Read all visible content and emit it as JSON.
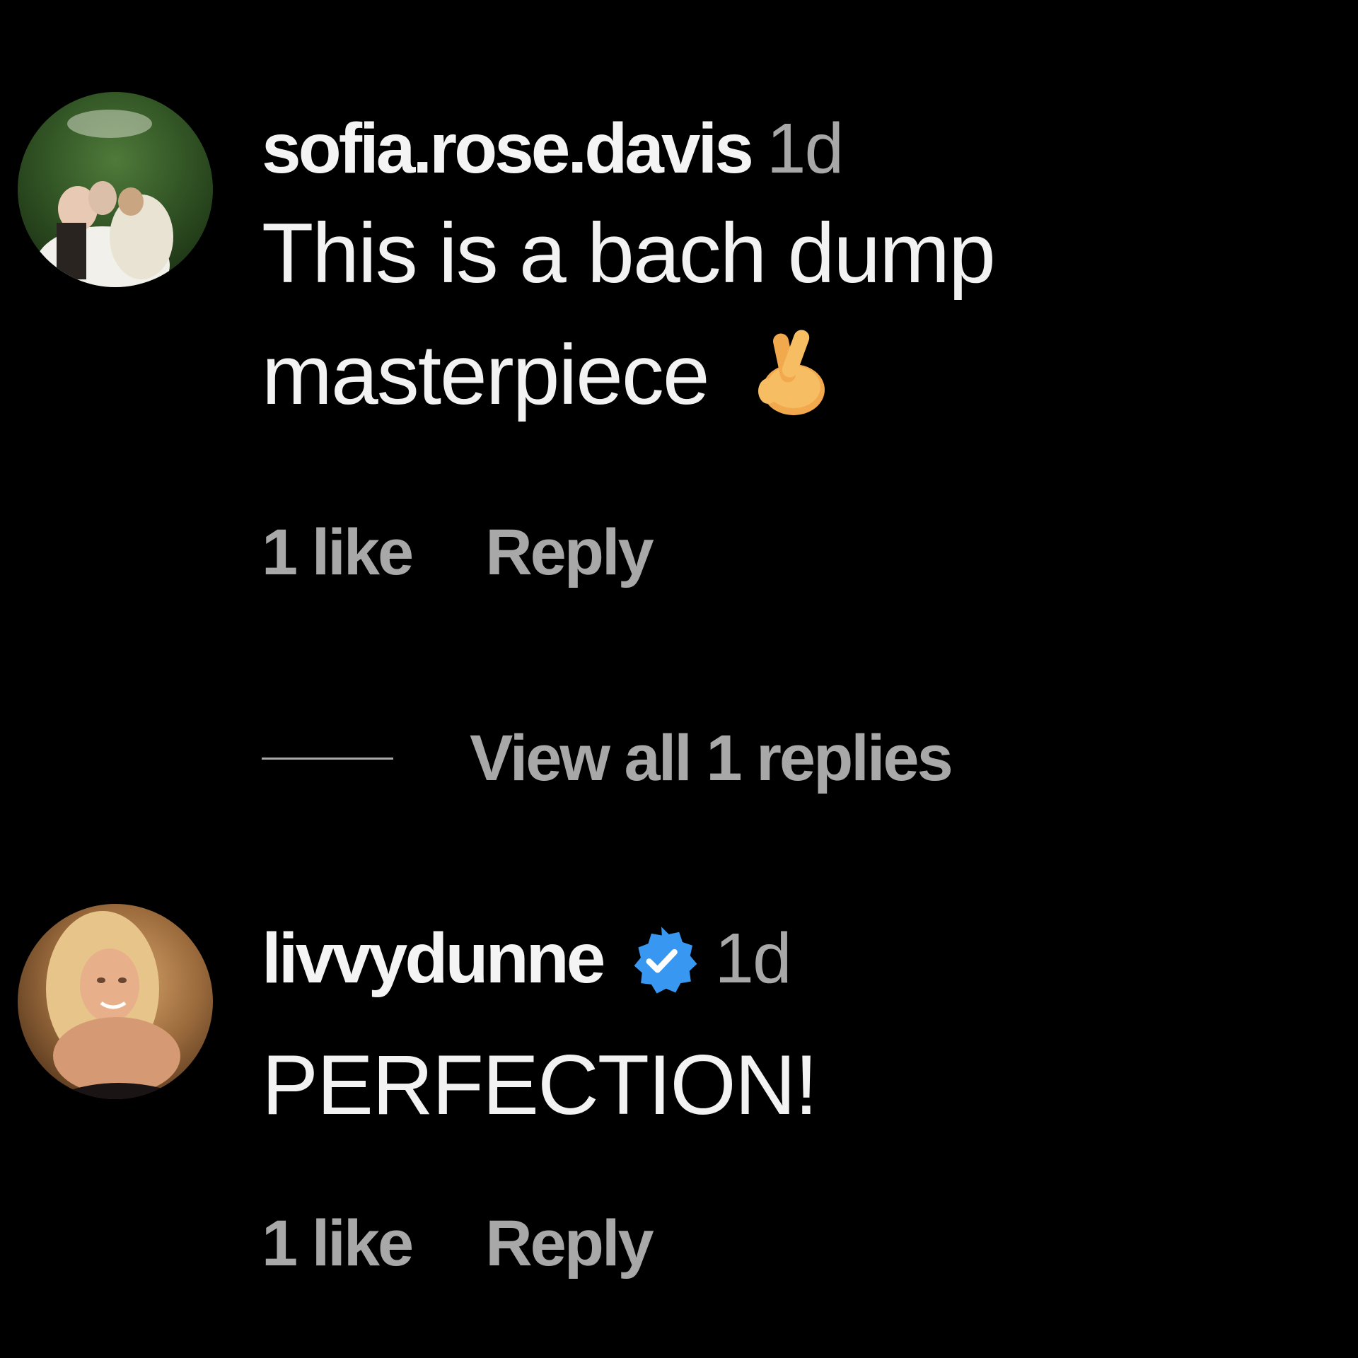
{
  "comments": [
    {
      "username": "sofia.rose.davis",
      "verified": false,
      "timestamp": "1d",
      "text_lines": [
        "This is a bach dump",
        "masterpiece"
      ],
      "emoji": "crossed-fingers-icon",
      "likes": "1 like",
      "reply_label": "Reply",
      "view_replies_label": "View all 1 replies"
    },
    {
      "username": "livvydunne",
      "verified": true,
      "timestamp": "1d",
      "text_lines": [
        "PERFECTION!"
      ],
      "likes": "1 like",
      "reply_label": "Reply"
    }
  ],
  "colors": {
    "background": "#000000",
    "primary_text": "#f2f2f2",
    "secondary_text": "#a8a8a8",
    "verified_badge": "#3897f0"
  }
}
